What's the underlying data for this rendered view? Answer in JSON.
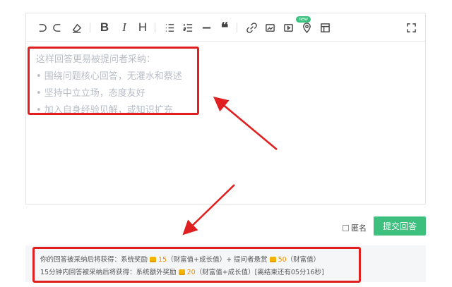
{
  "toolbar": {
    "items": [
      "undo-icon",
      "redo-icon",
      "eraser-icon",
      "bold",
      "italic",
      "heading",
      "unordered-list-icon",
      "ordered-list-icon",
      "horizontal-rule-icon",
      "quote-icon",
      "link-icon",
      "image-icon",
      "video-icon",
      "location-icon",
      "table-icon",
      "fullscreen-icon"
    ],
    "bold_label": "B",
    "italic_label": "I",
    "heading_label": "H",
    "new_badge": "new"
  },
  "editor": {
    "placeholder_title": "这样回答更易被提问者采纳：",
    "placeholder_items": [
      "• 围绕问题核心回答，无灌水和蔡述",
      "• 坚持中立立场，态度友好",
      "• 加入自身经验见解，或知识扩充"
    ]
  },
  "actions": {
    "anonymous_label": "匿名",
    "submit_label": "提交回答"
  },
  "reward_info": {
    "line1_pre": "你的回答被采纳后将获得：系统奖励",
    "line1_num1": "15",
    "line1_mid": "（财富值+成长值）+ 提问者悬赏",
    "line1_num2": "50",
    "line1_post": "（财富值）",
    "line2_pre": "15分钟内回答被采纳后将获得：系统额外奖励",
    "line2_num": "20",
    "line2_post": "（财富值+成长值）[离结束还有05分16秒]"
  },
  "colors": {
    "accent_green": "#3dbf7e",
    "annotation_red": "#e02020",
    "reward_orange": "#f08c00"
  }
}
